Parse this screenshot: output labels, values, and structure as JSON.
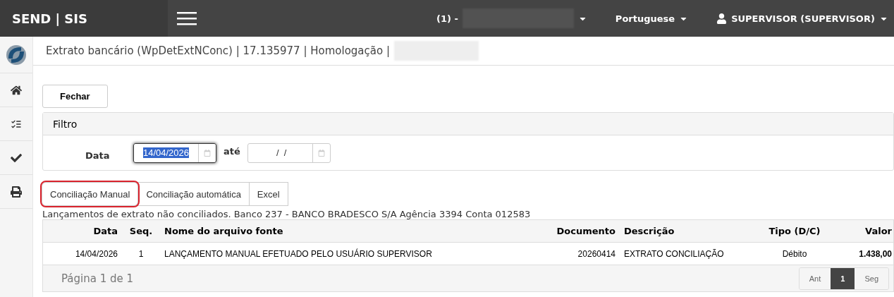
{
  "topbar": {
    "logo": "SEND | SIS",
    "company_prefix": "(1) -",
    "language": "Portuguese",
    "user": "SUPERVISOR (SUPERVISOR)"
  },
  "sidebar": {
    "items": [
      {
        "kind": "home"
      },
      {
        "kind": "list"
      },
      {
        "kind": "check"
      },
      {
        "kind": "print"
      }
    ]
  },
  "breadcrumb": "Extrato bancário (WpDetExtNConc) | 17.135977 | Homologação |",
  "close_button": "Fechar",
  "filter": {
    "title": "Filtro",
    "label": "Data",
    "from": {
      "value": "14/04/2026",
      "focused": true
    },
    "to_label": "até",
    "to": {
      "value": " /  /",
      "focused": false
    }
  },
  "actions": [
    {
      "label": "Conciliação Manual",
      "focused": true
    },
    {
      "label": "Conciliação automática",
      "focused": false
    },
    {
      "label": "Excel",
      "focused": false
    }
  ],
  "caption": "Lançamentos de extrato não conciliados. Banco 237 - BANCO BRADESCO S/A Agência 3394 Conta 012583",
  "table": {
    "columns": [
      "Data",
      "Seq.",
      "Nome do arquivo fonte",
      "Documento",
      "Descrição",
      "Tipo (D/C)",
      "Valor"
    ],
    "rows": [
      [
        "14/04/2026",
        "1",
        "LANÇAMENTO MANUAL EFETUADO PELO USUÁRIO SUPERVISOR",
        "20260414",
        "EXTRATO CONCILIAÇÃO",
        "Débito",
        "1.438,00"
      ]
    ]
  },
  "pager": {
    "label": "Página 1 de 1",
    "prev": "Ant",
    "pages": [
      {
        "label": "1",
        "selected": true
      }
    ],
    "next": "Seg"
  }
}
